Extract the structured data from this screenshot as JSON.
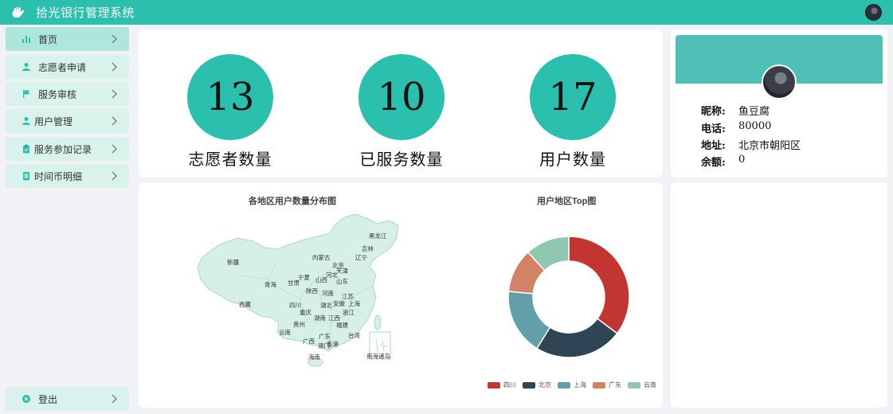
{
  "header": {
    "title": "拾光银行管理系统",
    "logo_icon": "hand-logo-icon",
    "avatar_icon": "user-avatar"
  },
  "sidebar": {
    "items": [
      {
        "label": "首页",
        "icon": "bar-chart-icon",
        "active": true
      },
      {
        "label": "志愿者申请",
        "icon": "user-icon",
        "active": false
      },
      {
        "label": "服务审核",
        "icon": "flag-icon",
        "active": false
      },
      {
        "label": "用户管理",
        "icon": "users-icon",
        "active": false
      },
      {
        "label": "服务参加记录",
        "icon": "clipboard-icon",
        "active": false
      },
      {
        "label": "时间币明细",
        "icon": "document-icon",
        "active": false
      }
    ],
    "logout": {
      "label": "登出",
      "icon": "close-circle-icon"
    }
  },
  "stats": [
    {
      "value": "13",
      "label": "志愿者数量"
    },
    {
      "value": "10",
      "label": "已服务数量"
    },
    {
      "value": "17",
      "label": "用户数量"
    }
  ],
  "profile": {
    "rows": [
      {
        "key": "昵称:",
        "value": "鱼豆腐"
      },
      {
        "key": "电话:",
        "value": "80000"
      },
      {
        "key": "地址:",
        "value": "北京市朝阳区"
      },
      {
        "key": "余额:",
        "value": "0"
      }
    ]
  },
  "colors": {
    "accent": "#2bbfad",
    "nav_bg": "#d9f3ec",
    "nav_active": "#aee6dd",
    "map_fill": "#d6f0e6"
  },
  "map": {
    "title": "各地区用户数量分布图",
    "provinces": [
      "黑龙江",
      "吉林",
      "辽宁",
      "内蒙古",
      "北京",
      "天津",
      "河北",
      "新疆",
      "宁夏",
      "山西",
      "山东",
      "青海",
      "甘肃",
      "陕西",
      "河南",
      "江苏",
      "西藏",
      "四川",
      "湖北",
      "安徽",
      "上海",
      "重庆",
      "浙江",
      "湖南",
      "江西",
      "贵州",
      "福建",
      "云南",
      "广西",
      "广东",
      "台湾",
      "澳门",
      "香港",
      "海南",
      "南海诸岛"
    ]
  },
  "chart_data": {
    "type": "pie",
    "title": "用户地区Top图",
    "categories": [
      "四川",
      "北京",
      "上海",
      "广东",
      "云南"
    ],
    "values": [
      6,
      4,
      3,
      2,
      2
    ],
    "colors": [
      "#c23531",
      "#2f4554",
      "#61a0a8",
      "#d48265",
      "#91c7ae"
    ],
    "legend": "bottom"
  }
}
